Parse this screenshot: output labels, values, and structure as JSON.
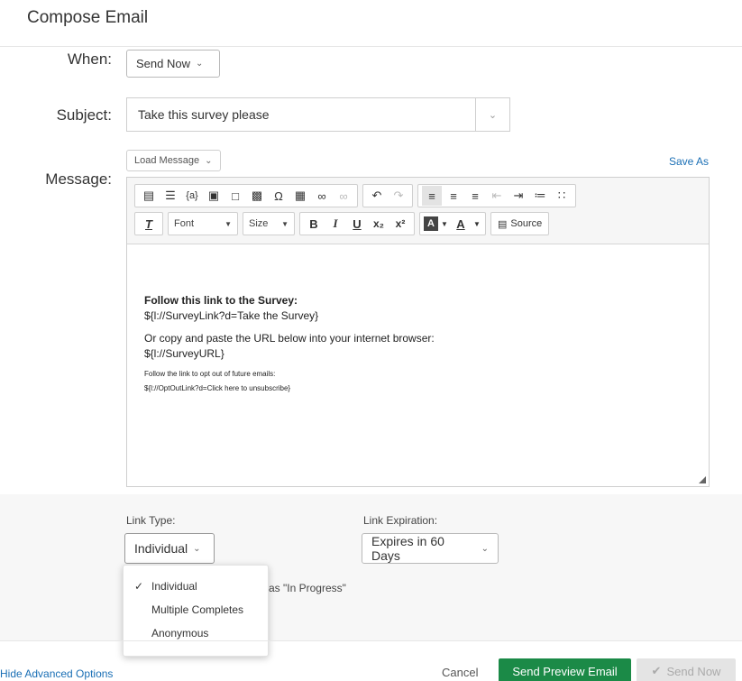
{
  "dialog": {
    "title": "Compose Email"
  },
  "when": {
    "label": "When:",
    "value": "Send Now"
  },
  "subject": {
    "label": "Subject:",
    "value": "Take this survey please"
  },
  "message": {
    "label": "Message:",
    "load_message": "Load Message",
    "save_as": "Save As",
    "toolbar": {
      "font_label": "Font",
      "size_label": "Size",
      "source_label": "Source",
      "icons": [
        "paste-icon",
        "bulleted-list-icon",
        "placeholder-icon",
        "image-icon",
        "page-icon",
        "media-icon",
        "special-character-icon",
        "table-icon",
        "link-icon",
        "unlink-icon",
        "undo-icon",
        "redo-icon",
        "align-left-icon",
        "align-center-icon",
        "align-right-icon",
        "outdent-icon",
        "indent-icon",
        "numbered-list-icon",
        "bullet-list-icon",
        "clear-format-icon",
        "bold-icon",
        "italic-icon",
        "underline-icon",
        "subscript-icon",
        "superscript-icon",
        "background-color-icon",
        "text-color-icon",
        "source-icon"
      ]
    },
    "body": {
      "line1": "Follow this link to the Survey:",
      "line2": "${l://SurveyLink?d=Take the Survey}",
      "line3": "Or copy and paste the URL below into your internet browser:",
      "line4": "${l://SurveyURL}",
      "line5": "Follow the link to opt out of future emails:",
      "line6": "${l://OptOutLink?d=Click here to unsubscribe}"
    }
  },
  "advanced": {
    "link_type_label": "Link Type:",
    "link_type_value": "Individual",
    "link_expiration_label": "Link Expiration:",
    "link_expiration_value": "Expires in 60 Days",
    "partial_text": "as \"In Progress\"",
    "link_type_menu": {
      "check_glyph": "✓",
      "options": [
        "Individual",
        "Multiple Completes",
        "Anonymous"
      ],
      "selected": "Individual"
    }
  },
  "footer": {
    "hide_advanced": "Hide Advanced Options",
    "cancel": "Cancel",
    "send_preview": "Send Preview Email",
    "send_now": "Send Now"
  },
  "colors": {
    "link_blue": "#1a6fb5",
    "primary_green": "#1b8a47",
    "disabled_gray": "#e4e4e4"
  }
}
